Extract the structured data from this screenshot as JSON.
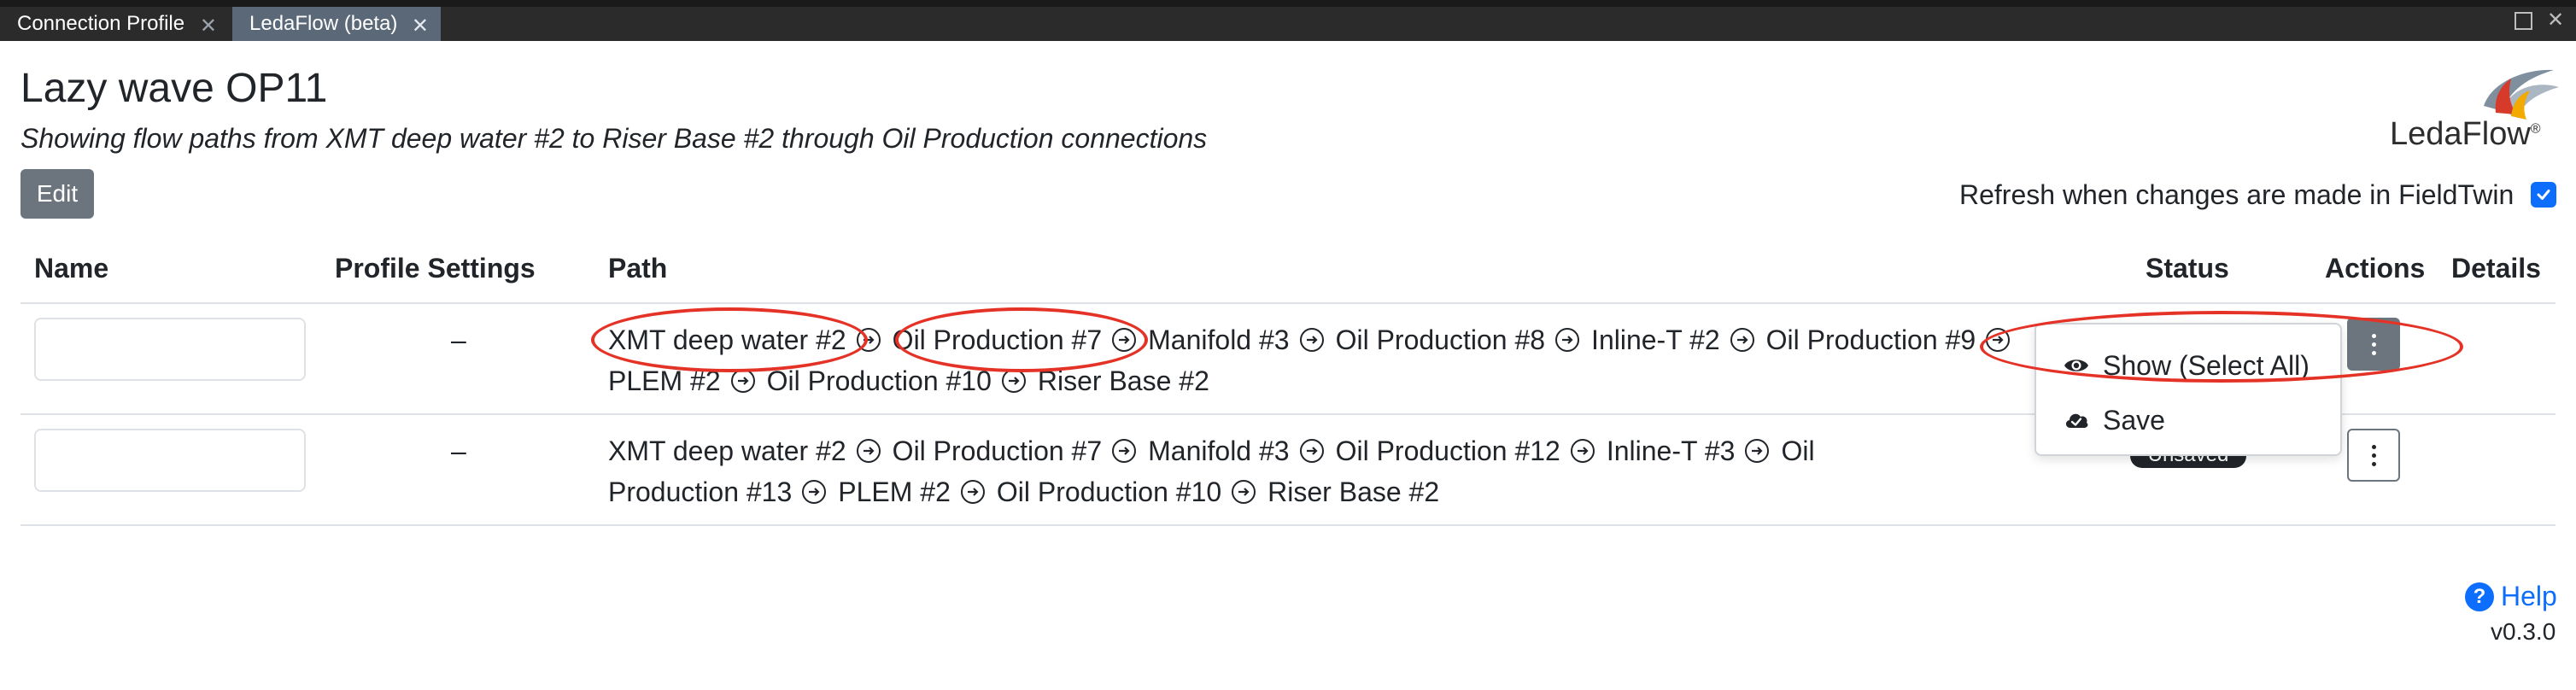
{
  "tabs": [
    {
      "label": "Connection Profile",
      "active": false
    },
    {
      "label": "LedaFlow (beta)",
      "active": true
    }
  ],
  "window_controls": {
    "maximize_icon": "maximize-icon",
    "close_icon": "close-icon",
    "close_glyph": "✕"
  },
  "tab_close_glyph": "✕",
  "header": {
    "title": "Lazy wave OP11",
    "subtitle": "Showing flow paths from XMT deep water #2 to Riser Base #2 through Oil Production connections",
    "edit_label": "Edit"
  },
  "logo": {
    "text": "LedaFlow",
    "mark": "®"
  },
  "refresh": {
    "label": "Refresh when changes are made in FieldTwin",
    "checked": true
  },
  "table": {
    "headers": {
      "name": "Name",
      "profile_settings": "Profile Settings",
      "path": "Path",
      "status": "Status",
      "actions": "Actions",
      "details": "Details"
    },
    "rows": [
      {
        "name": "",
        "profile_settings": "–",
        "path": [
          "XMT deep water #2",
          "Oil Production #7",
          "Manifold #3",
          "Oil Production #8",
          "Inline-T #2",
          "Oil Production #9",
          "PLEM #2",
          "Oil Production #10",
          "Riser Base #2"
        ],
        "status": ""
      },
      {
        "name": "",
        "profile_settings": "–",
        "path": [
          "XMT deep water #2",
          "Oil Production #7",
          "Manifold #3",
          "Oil Production #12",
          "Inline-T #3",
          "Oil Production #13",
          "PLEM #2",
          "Oil Production #10",
          "Riser Base #2"
        ],
        "status": "Unsaved"
      }
    ]
  },
  "menu": {
    "items": [
      {
        "label": "Show (Select All)",
        "icon": "eye-icon"
      },
      {
        "label": "Save",
        "icon": "cloud-check-icon"
      }
    ]
  },
  "footer": {
    "help_label": "Help",
    "help_glyph": "?",
    "version": "v0.3.0"
  },
  "colors": {
    "accent": "#0d6efd",
    "secondary": "#6c757d",
    "annotation": "#e53226",
    "active_tab": "#5a6877"
  }
}
